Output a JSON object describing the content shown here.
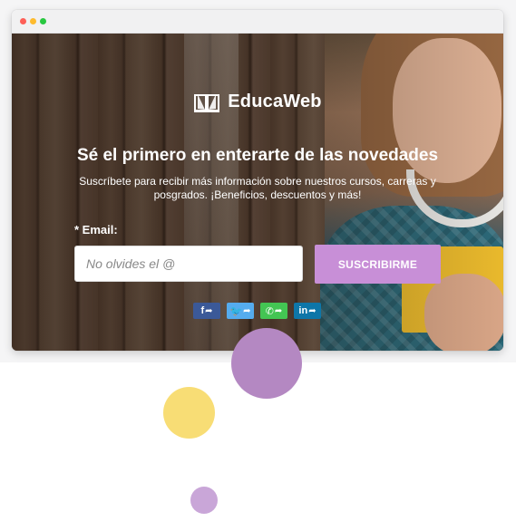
{
  "brand": {
    "name": "EducaWeb"
  },
  "hero": {
    "headline": "Sé el primero en enterarte de las novedades",
    "subtext": "Suscríbete para recibir más información sobre nuestros cursos, carreras y posgrados. ¡Beneficios, descuentos y más!"
  },
  "form": {
    "email_label": "* Email:",
    "email_placeholder": "No olvides el @",
    "email_value": "",
    "submit_label": "SUSCRIBIRME"
  },
  "social": [
    {
      "name": "facebook",
      "glyph": "f",
      "color": "#3b5998",
      "icon": "facebook-share-icon"
    },
    {
      "name": "twitter",
      "glyph": "🐦",
      "color": "#55acee",
      "icon": "twitter-share-icon"
    },
    {
      "name": "whatsapp",
      "glyph": "✆",
      "color": "#43c553",
      "icon": "whatsapp-share-icon"
    },
    {
      "name": "linkedin",
      "glyph": "in",
      "color": "#0e76a8",
      "icon": "linkedin-share-icon"
    }
  ],
  "colors": {
    "accent_button": "#c88fd7",
    "circle_purple": "#b488c2",
    "circle_yellow": "#f8dd75",
    "circle_lilac": "#c9a6d8"
  }
}
